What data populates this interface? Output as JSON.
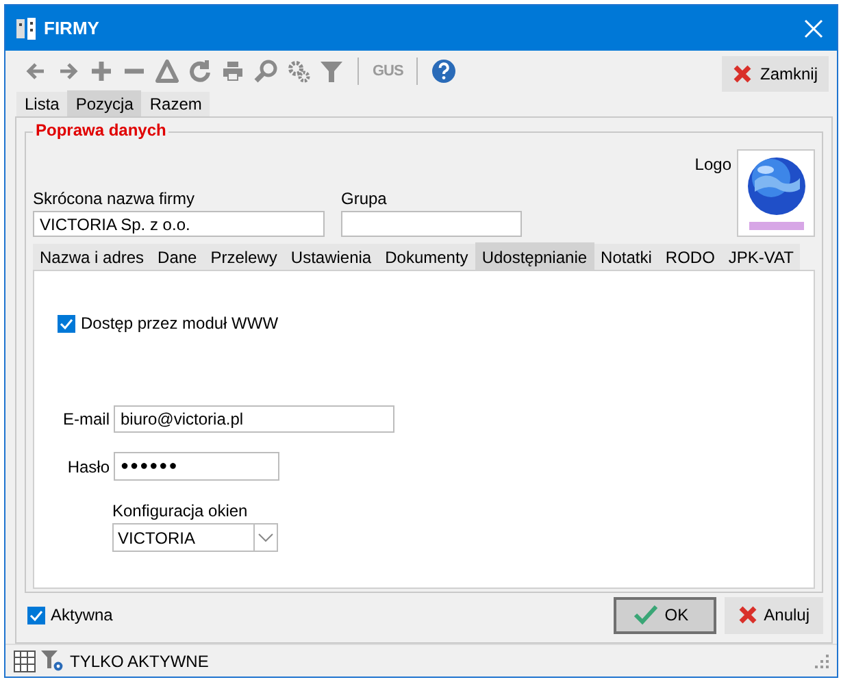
{
  "window": {
    "title": "FIRMY"
  },
  "toolbar": {
    "gus_button": "GUS",
    "close_button": "Zamknij"
  },
  "view_tabs": [
    {
      "label": "Lista",
      "selected": false
    },
    {
      "label": "Pozycja",
      "selected": true
    },
    {
      "label": "Razem",
      "selected": false
    }
  ],
  "form": {
    "group_title": "Poprawa danych",
    "short_name": {
      "label": "Skrócona nazwa firmy",
      "value": "VICTORIA Sp. z o.o."
    },
    "group": {
      "label": "Grupa"
    },
    "logo": {
      "label": "Logo",
      "kind": "picture"
    }
  },
  "detail_tabs": [
    {
      "label": "Nazwa i adres",
      "selected": false
    },
    {
      "label": "Dane",
      "selected": false
    },
    {
      "label": "Przelewy",
      "selected": false
    },
    {
      "label": "Ustawienia",
      "selected": false
    },
    {
      "label": "Dokumenty",
      "selected": false
    },
    {
      "label": "Udostępnianie",
      "selected": true
    },
    {
      "label": "Notatki",
      "selected": false
    },
    {
      "label": "RODO",
      "selected": false
    },
    {
      "label": "JPK-VAT",
      "selected": false
    }
  ],
  "sharing": {
    "www_access": {
      "label": "Dostęp przez moduł WWW",
      "checked": true
    },
    "email": {
      "label": "E-mail",
      "value": "biuro@victoria.pl"
    },
    "password": {
      "label": "Hasło",
      "value": "●●●●●●"
    },
    "window_config": {
      "label": "Konfiguracja okien",
      "value": "VICTORIA"
    }
  },
  "active": {
    "label": "Aktywna",
    "checked": true
  },
  "buttons": [
    {
      "label": "OK",
      "kind": "ok"
    },
    {
      "label": "Anuluj",
      "kind": "cancel"
    }
  ],
  "status_bar": {
    "filter": "TYLKO AKTYWNE"
  }
}
